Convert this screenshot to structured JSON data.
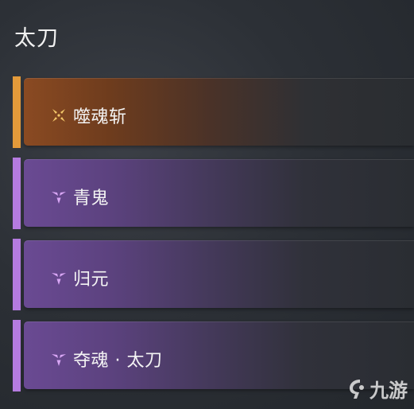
{
  "title": "太刀",
  "skills": [
    {
      "name": "噬魂斩",
      "rarity": "orange",
      "icon": "sparkle-icon"
    },
    {
      "name": "青鬼",
      "rarity": "purple",
      "icon": "tri-gem-icon"
    },
    {
      "name": "归元",
      "rarity": "purple",
      "icon": "tri-gem-icon"
    },
    {
      "name": "夺魂 · 太刀",
      "rarity": "purple",
      "icon": "tri-gem-icon"
    }
  ],
  "colors": {
    "orange_accent": "#e39a3a",
    "purple_accent": "#b57be0",
    "orange_icon": "#f3c86a",
    "purple_icon": "#d9a6f5"
  },
  "watermark": {
    "text": "九游",
    "icon": "j9-logo-icon"
  }
}
